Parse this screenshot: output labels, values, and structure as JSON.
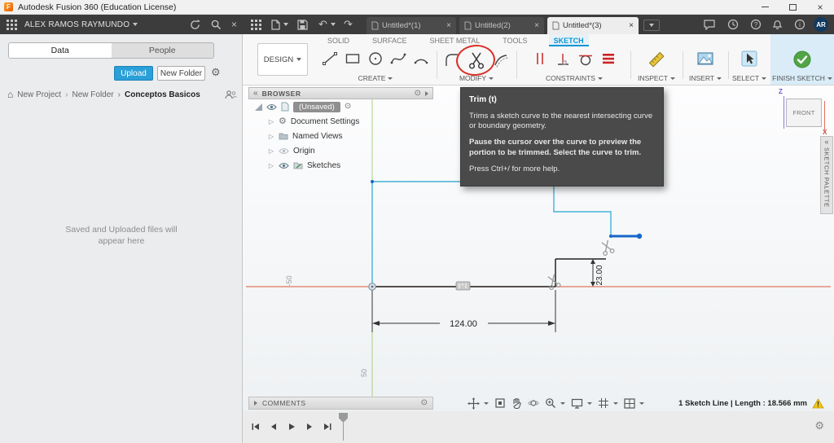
{
  "window": {
    "title": "Autodesk Fusion 360 (Education License)",
    "logo": "F"
  },
  "appbar": {
    "user": "ALEX RAMOS RAYMUNDO",
    "avatar": "AR",
    "tabs": [
      {
        "label": "Untitled*(1)"
      },
      {
        "label": "Untitled(2)"
      },
      {
        "label": "Untitled*(3)"
      }
    ]
  },
  "data_panel": {
    "tab_data": "Data",
    "tab_people": "People",
    "upload": "Upload",
    "new_folder": "New Folder",
    "breadcrumb": {
      "root": "New Project",
      "mid": "New Folder",
      "current": "Conceptos Basicos"
    },
    "empty_line1": "Saved and Uploaded files will",
    "empty_line2": "appear here"
  },
  "toolbar": {
    "design": "DESIGN",
    "workspace_tabs": [
      "SOLID",
      "SURFACE",
      "SHEET METAL",
      "TOOLS",
      "SKETCH"
    ],
    "active_tab": "SKETCH",
    "groups": {
      "create": "CREATE",
      "modify": "MODIFY",
      "constraints": "CONSTRAINTS",
      "inspect": "INSPECT",
      "insert": "INSERT",
      "select": "SELECT",
      "finish": "FINISH SKETCH"
    }
  },
  "browser": {
    "title": "BROWSER",
    "root": "(Unsaved)",
    "items": [
      "Document Settings",
      "Named Views",
      "Origin",
      "Sketches"
    ]
  },
  "tooltip": {
    "title": "Trim (t)",
    "p1": "Trims a sketch curve to the nearest intersecting curve or boundary geometry.",
    "p2": "Pause the cursor over the curve to preview the portion to be trimmed. Select the curve to trim.",
    "p3": "Press Ctrl+/ for more help."
  },
  "canvas": {
    "dim_width": "124.00",
    "dim_height": "23.00",
    "axis_neg": "-50",
    "axis_pos": "50",
    "viewcube": {
      "face": "FRONT",
      "z": "Z",
      "x": "X"
    },
    "sketch_palette": "SKETCH PALETTE",
    "comments": "COMMENTS"
  },
  "status": {
    "text": "1 Sketch Line | Length : 18.566 mm"
  },
  "icons": {
    "close": "×",
    "gear": "⚙",
    "target": "⊙",
    "collapse": "«",
    "expander": "▷",
    "home": "⌂",
    "undo": "↶",
    "redo": "↷",
    "question": "?",
    "info": "i",
    "exclaim": "!"
  },
  "colors": {
    "accent_blue": "#0696d7",
    "selected_line_blue": "#1667c9",
    "sketch_cyan": "#43b1d5",
    "axis_red": "#dd7860",
    "axis_green": "#aacf7e",
    "finish_green": "#52a546",
    "warning_yellow": "#f2c51b",
    "annotation_red": "#d93025"
  }
}
